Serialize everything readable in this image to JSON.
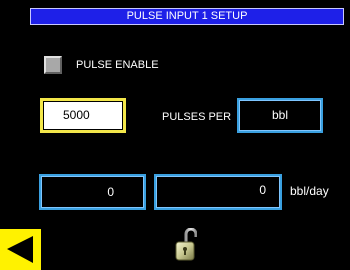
{
  "header": {
    "title": "PULSE INPUT 1 SETUP"
  },
  "pulse_enable": {
    "label": "PULSE ENABLE",
    "checked": false
  },
  "pulses": {
    "value": "5000",
    "per_label": "PULSES PER",
    "unit": "bbl"
  },
  "readouts": {
    "left_value": "0",
    "right_value": "0",
    "rate_unit": "bbl/day"
  },
  "icons": {
    "back": "back-arrow-icon",
    "lock": "unlocked-padlock-icon"
  },
  "colors": {
    "background": "#000000",
    "title_bar": "#1e20e8",
    "active_border": "#f3e74a",
    "field_border": "#3aa0e0",
    "back_button": "#fff200"
  }
}
